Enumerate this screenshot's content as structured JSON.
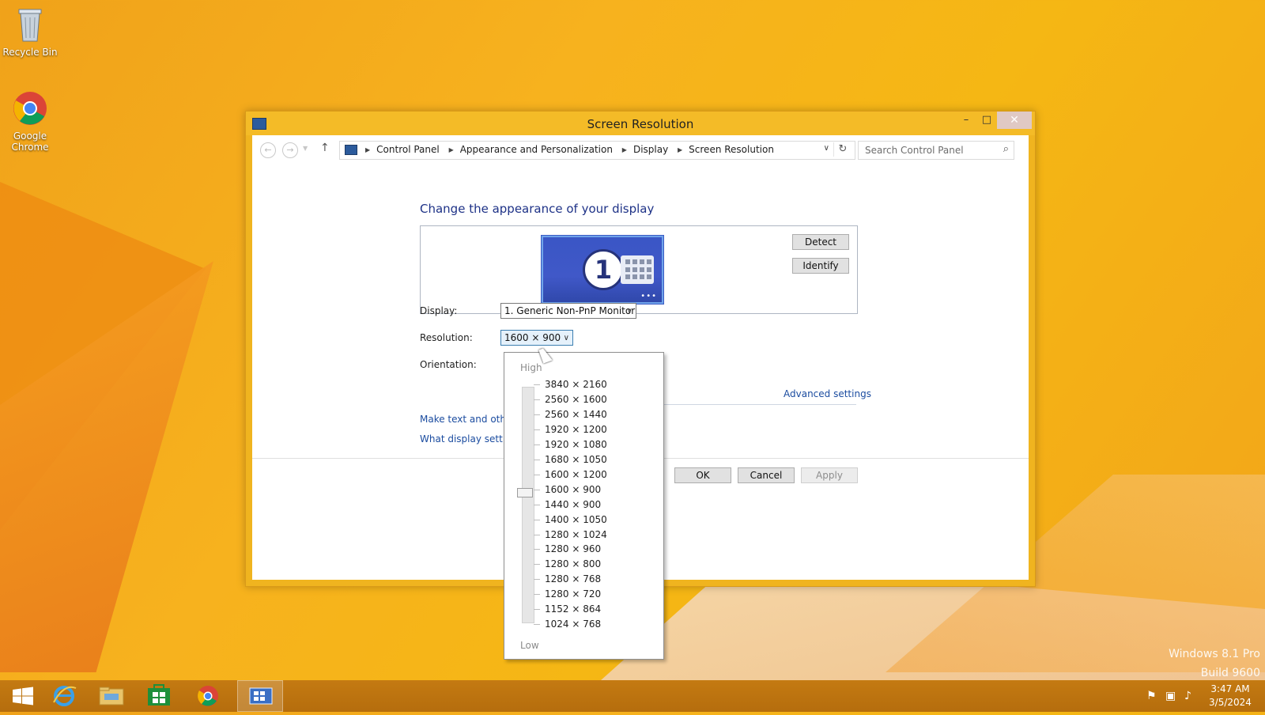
{
  "desktop": {
    "icons": [
      {
        "label": "Recycle Bin"
      },
      {
        "label": "Google Chrome"
      }
    ],
    "watermark": {
      "line1": "Windows 8.1 Pro",
      "line2": "Build 9600"
    }
  },
  "window": {
    "title": "Screen Resolution",
    "controls": {
      "minimize": "–",
      "maximize": "□",
      "close": "✕"
    }
  },
  "nav": {
    "breadcrumbs": [
      "Control Panel",
      "Appearance and Personalization",
      "Display",
      "Screen Resolution"
    ],
    "search_placeholder": "Search Control Panel"
  },
  "main": {
    "heading": "Change the appearance of your display",
    "monitor_number": "1",
    "detect_label": "Detect",
    "identify_label": "Identify",
    "display_label": "Display:",
    "display_value": "1. Generic Non-PnP Monitor",
    "resolution_label": "Resolution:",
    "resolution_value": "1600 × 900",
    "orientation_label": "Orientation:",
    "advanced_settings": "Advanced settings",
    "link_text": "Make text and other",
    "link_what": "What display setting",
    "ok_label": "OK",
    "cancel_label": "Cancel",
    "apply_label": "Apply"
  },
  "resolution_dropdown": {
    "high_label": "High",
    "low_label": "Low",
    "options": [
      "3840 × 2160",
      "2560 × 1600",
      "2560 × 1440",
      "1920 × 1200",
      "1920 × 1080",
      "1680 × 1050",
      "1600 × 1200",
      "1600 × 900",
      "1440 × 900",
      "1400 × 1050",
      "1280 × 1024",
      "1280 × 960",
      "1280 × 800",
      "1280 × 768",
      "1280 × 720",
      "1152 × 864",
      "1024 × 768"
    ],
    "selected": "1600 × 900"
  },
  "taskbar": {
    "time": "3:47 AM",
    "date": "3/5/2024"
  },
  "colors": {
    "accent_link": "#1a4b9f",
    "title_bar": "#f4bb27",
    "monitor": "#3a56c5"
  }
}
